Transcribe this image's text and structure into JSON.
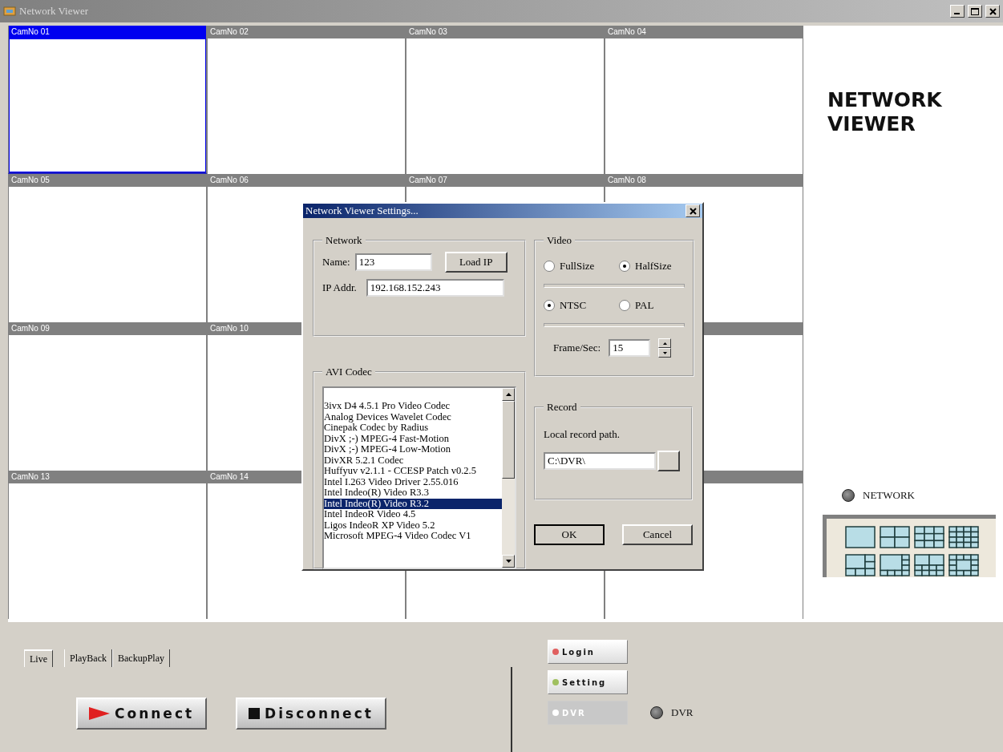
{
  "window": {
    "title": "Network Viewer"
  },
  "camera_rows": [
    [
      {
        "label": "CamNo 01",
        "selected": true
      },
      {
        "label": "CamNo 02",
        "selected": false
      },
      {
        "label": "CamNo 03",
        "selected": false
      },
      {
        "label": "CamNo 04",
        "selected": false
      }
    ],
    [
      {
        "label": "CamNo 05",
        "selected": false
      },
      {
        "label": "CamNo 06",
        "selected": false
      },
      {
        "label": "CamNo 07",
        "selected": false
      },
      {
        "label": "CamNo 08",
        "selected": false
      }
    ],
    [
      {
        "label": "CamNo 09",
        "selected": false
      },
      {
        "label": "CamNo 10",
        "selected": false
      }
    ],
    [
      {
        "label": "CamNo 13",
        "selected": false
      },
      {
        "label": "CamNo 14",
        "selected": false
      }
    ]
  ],
  "logo": [
    "NETWORK",
    "VIEWER"
  ],
  "network_status": {
    "label": "NETWORK"
  },
  "layouts": [
    {
      "kind": "single"
    },
    {
      "kind": "quad"
    },
    {
      "kind": "nine"
    },
    {
      "kind": "sixteen"
    },
    {
      "kind": "six"
    },
    {
      "kind": "eight"
    },
    {
      "kind": "ten"
    },
    {
      "kind": "thirteen"
    }
  ],
  "tabs": [
    {
      "label": "Live",
      "selected": true
    },
    {
      "label": "PlayBack",
      "selected": false
    },
    {
      "label": "BackupPlay",
      "selected": false
    }
  ],
  "actions": [
    {
      "kind": "play",
      "label": "Connect"
    },
    {
      "kind": "stop",
      "label": "Disconnect"
    }
  ],
  "side_buttons": [
    {
      "label": "Login",
      "disabled": false
    },
    {
      "label": "Setting",
      "disabled": false
    },
    {
      "label": "DVR",
      "disabled": true
    }
  ],
  "dvr_status": {
    "label": "DVR"
  },
  "dialog": {
    "title": "Network Viewer Settings...",
    "network": {
      "title": "Network",
      "name_label": "Name:",
      "name": "123",
      "load_button": "Load IP",
      "ip_label": "IP Addr.",
      "ip": "192.168.152.243"
    },
    "codec": {
      "title": "AVI Codec",
      "items": [
        {
          "label": "3ivx D4 4.5.1 Pro Video Codec",
          "selected": false
        },
        {
          "label": "Analog Devices Wavelet Codec",
          "selected": false
        },
        {
          "label": "Cinepak Codec by Radius",
          "selected": false
        },
        {
          "label": "DivX ;-) MPEG-4 Fast-Motion",
          "selected": false
        },
        {
          "label": "DivX ;-) MPEG-4 Low-Motion",
          "selected": false
        },
        {
          "label": "DivXR 5.2.1 Codec",
          "selected": false
        },
        {
          "label": "Huffyuv v2.1.1 - CCESP Patch v0.2.5",
          "selected": false
        },
        {
          "label": "Intel I.263 Video Driver 2.55.016",
          "selected": false
        },
        {
          "label": "Intel Indeo(R) Video R3.3",
          "selected": false
        },
        {
          "label": "Intel Indeo(R) Video R3.2",
          "selected": true
        },
        {
          "label": "Intel IndeoR Video 4.5",
          "selected": false
        },
        {
          "label": "Ligos IndeoR XP Video 5.2",
          "selected": false
        },
        {
          "label": "Microsoft MPEG-4 Video Codec V1",
          "selected": false
        }
      ]
    },
    "video": {
      "title": "Video",
      "sizes": [
        {
          "label": "FullSize",
          "selected": false
        },
        {
          "label": "HalfSize",
          "selected": true
        }
      ],
      "standards": [
        {
          "label": "NTSC",
          "selected": true
        },
        {
          "label": "PAL",
          "selected": false
        }
      ],
      "fps_label": "Frame/Sec:",
      "fps": "15"
    },
    "record": {
      "title": "Record",
      "path_label": "Local record path.",
      "path": "C:\\DVR\\"
    },
    "buttons": [
      "OK",
      "Cancel"
    ]
  }
}
